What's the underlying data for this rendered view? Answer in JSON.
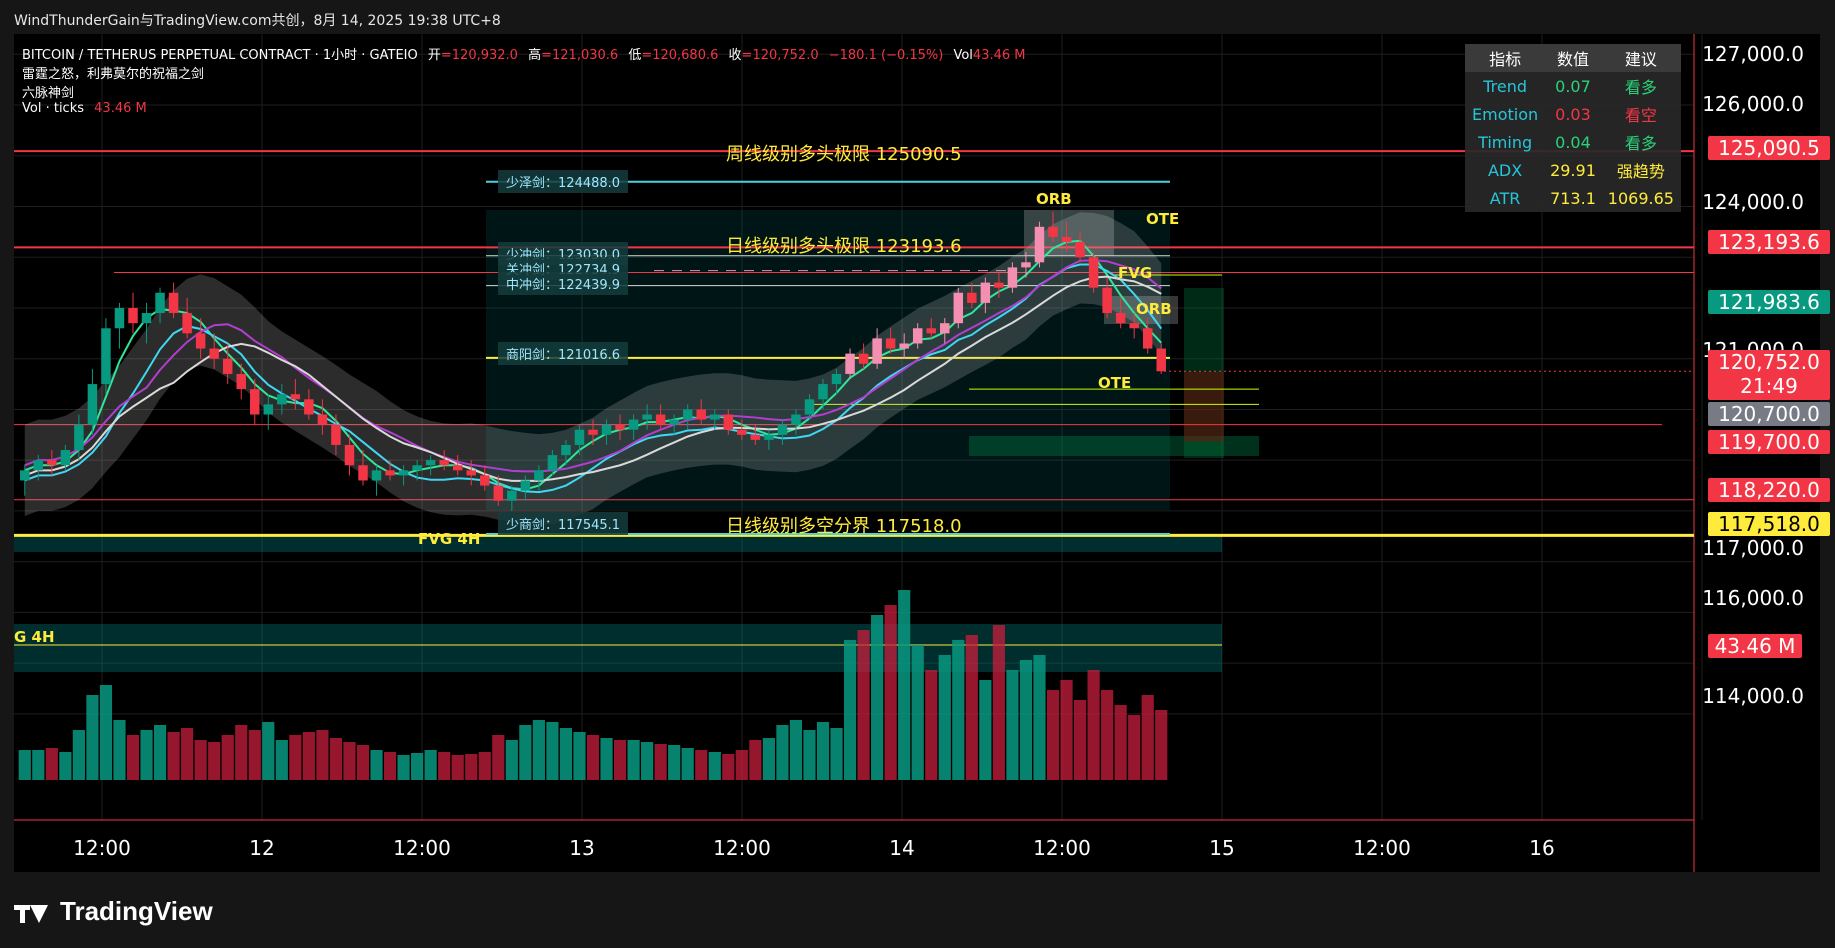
{
  "header": {
    "text": "WindThunderGain与TradingView.com共创，8月 14, 2025 19:38 UTC+8"
  },
  "legend": {
    "symbol": "BITCOIN / TETHERUS PERPETUAL CONTRACT · 1小时 · GATEIO",
    "o_label": "开",
    "o": "=120,932.0",
    "h_label": "高",
    "h": "=121,030.6",
    "l_label": "低",
    "l": "=120,680.6",
    "c_label": "收",
    "c": "=120,752.0",
    "change": "−180.1 (−0.15%)",
    "vol_label": "Vol",
    "vol": "43.46 M",
    "line2": "雷霆之怒，利弗莫尔的祝福之剑",
    "line3": "六脉神剑",
    "line4": "Vol · ticks",
    "line4_val": "43.46 M"
  },
  "indicator_table": {
    "headers": [
      "指标",
      "数值",
      "建议"
    ],
    "rows": [
      {
        "name": "Trend",
        "value": "0.07",
        "advice": "看多",
        "name_color": "#26c6da",
        "value_color": "#29d37a",
        "advice_color": "#29d37a"
      },
      {
        "name": "Emotion",
        "value": "0.03",
        "advice": "看空",
        "name_color": "#26c6da",
        "value_color": "#f23645",
        "advice_color": "#f23645"
      },
      {
        "name": "Timing",
        "value": "0.04",
        "advice": "看多",
        "name_color": "#26c6da",
        "value_color": "#29d37a",
        "advice_color": "#29d37a"
      },
      {
        "name": "ADX",
        "value": "29.91",
        "advice": "强趋势",
        "name_color": "#26c6da",
        "value_color": "#ffeb3b",
        "advice_color": "#ffeb3b"
      },
      {
        "name": "ATR",
        "value": "713.1",
        "advice": "1069.65",
        "name_color": "#26c6da",
        "value_color": "#ffeb3b",
        "advice_color": "#ffeb3b"
      }
    ]
  },
  "price_axis": [
    "127,000.0",
    "126,000.0",
    "124,000.0",
    "121,000.0",
    "117,000.0",
    "116,000.0",
    "114,000.0"
  ],
  "price_tags": [
    {
      "text": "125,090.5",
      "bg": "#f23645",
      "fg": "#ffffff",
      "price": 125090.5
    },
    {
      "text": "123,193.6",
      "bg": "#f23645",
      "fg": "#ffffff",
      "price": 123193.6
    },
    {
      "text": "121,983.6",
      "bg": "#089981",
      "fg": "#ffffff",
      "price": 121983.6
    },
    {
      "text": "120,752.0",
      "bg": "#f23645",
      "fg": "#ffffff",
      "price": 120752.0
    },
    {
      "text": "21:49",
      "bg": "#f23645",
      "fg": "#ffffff",
      "price": 120752.0
    },
    {
      "text": "120,700.0",
      "bg": "#787b86",
      "fg": "#ffffff",
      "price": 120700.0
    },
    {
      "text": "119,700.0",
      "bg": "#f23645",
      "fg": "#ffffff",
      "price": 119700.0
    },
    {
      "text": "118,220.0",
      "bg": "#f23645",
      "fg": "#ffffff",
      "price": 118220.0
    },
    {
      "text": "117,518.0",
      "bg": "#ffeb3b",
      "fg": "#000000",
      "price": 117518.0
    },
    {
      "text": "43.46 M",
      "bg": "#f23645",
      "fg": "#ffffff",
      "price": null
    }
  ],
  "time_axis": [
    "12:00",
    "12",
    "12:00",
    "13",
    "12:00",
    "14",
    "12:00",
    "15",
    "12:00",
    "16"
  ],
  "chart_labels": {
    "weekly": "周线级别多头极限 125090.5",
    "daily_bull": "日线级别多头极限 123193.6",
    "daily_split": "日线级别多空分界 117518.0",
    "fvg4h": "FVG 4H",
    "fvg4h_left": "G 4H",
    "orb": "ORB",
    "ote": "OTE",
    "fvg": "FVG"
  },
  "swords": [
    {
      "name": "少泽剑",
      "value": "124488.0"
    },
    {
      "name": "少冲剑",
      "value": "123030.0"
    },
    {
      "name": "关冲剑",
      "value": "122734.9"
    },
    {
      "name": "中冲剑",
      "value": "122439.9"
    },
    {
      "name": "商阳剑",
      "value": "121016.6"
    },
    {
      "name": "少商剑",
      "value": "117545.1"
    }
  ],
  "footer": {
    "brand": "TradingView"
  },
  "colors": {
    "up": "#089981",
    "down": "#f23645",
    "ma_magenta": "#b23ecf",
    "ma_green": "#2ee89a",
    "ma_cyan": "#3fd7f2",
    "ma_white": "#d9d9d9",
    "yellow": "#ffeb3b"
  },
  "chart_data": {
    "type": "candlestick",
    "price_range": [
      113800,
      127400
    ],
    "candles": [
      [
        118600,
        118900,
        118300,
        118800
      ],
      [
        118800,
        119100,
        118600,
        119000
      ],
      [
        119000,
        119200,
        118700,
        118900
      ],
      [
        118900,
        119300,
        118800,
        119200
      ],
      [
        119200,
        119900,
        119000,
        119700
      ],
      [
        119700,
        120800,
        119500,
        120500
      ],
      [
        120500,
        121800,
        120300,
        121600
      ],
      [
        121600,
        122100,
        121200,
        122000
      ],
      [
        122000,
        122300,
        121500,
        121700
      ],
      [
        121700,
        122100,
        121300,
        121900
      ],
      [
        121900,
        122400,
        121700,
        122300
      ],
      [
        122300,
        122500,
        121800,
        121900
      ],
      [
        121900,
        122200,
        121400,
        121500
      ],
      [
        121500,
        121800,
        121000,
        121200
      ],
      [
        121200,
        121500,
        120800,
        121000
      ],
      [
        121000,
        121300,
        120500,
        120700
      ],
      [
        120700,
        120900,
        120200,
        120400
      ],
      [
        120400,
        120600,
        119700,
        119900
      ],
      [
        119900,
        120300,
        119600,
        120100
      ],
      [
        120100,
        120500,
        119900,
        120300
      ],
      [
        120300,
        120600,
        120000,
        120200
      ],
      [
        120200,
        120400,
        119800,
        119900
      ],
      [
        119900,
        120200,
        119500,
        119700
      ],
      [
        119700,
        119900,
        119100,
        119300
      ],
      [
        119300,
        119500,
        118700,
        118900
      ],
      [
        118900,
        119200,
        118500,
        118600
      ],
      [
        118600,
        118900,
        118300,
        118800
      ],
      [
        118800,
        119000,
        118600,
        118700
      ],
      [
        118700,
        118900,
        118500,
        118800
      ],
      [
        118800,
        119000,
        118600,
        118900
      ],
      [
        118900,
        119100,
        118700,
        119000
      ],
      [
        119000,
        119200,
        118800,
        118900
      ],
      [
        118900,
        119100,
        118700,
        118800
      ],
      [
        118800,
        119000,
        118500,
        118700
      ],
      [
        118700,
        118900,
        118400,
        118500
      ],
      [
        118500,
        118700,
        118100,
        118200
      ],
      [
        118200,
        118500,
        118000,
        118400
      ],
      [
        118400,
        118700,
        118200,
        118600
      ],
      [
        118600,
        118900,
        118400,
        118800
      ],
      [
        118800,
        119200,
        118700,
        119100
      ],
      [
        119100,
        119400,
        118900,
        119300
      ],
      [
        119300,
        119700,
        119100,
        119600
      ],
      [
        119600,
        119800,
        119300,
        119500
      ],
      [
        119500,
        119800,
        119300,
        119700
      ],
      [
        119700,
        119900,
        119400,
        119600
      ],
      [
        119600,
        119900,
        119400,
        119800
      ],
      [
        119800,
        120100,
        119600,
        119900
      ],
      [
        119900,
        120100,
        119600,
        119700
      ],
      [
        119700,
        119900,
        119500,
        119800
      ],
      [
        119800,
        120100,
        119600,
        120000
      ],
      [
        120000,
        120200,
        119700,
        119800
      ],
      [
        119800,
        120000,
        119600,
        119900
      ],
      [
        119900,
        120000,
        119500,
        119600
      ],
      [
        119600,
        119800,
        119400,
        119500
      ],
      [
        119500,
        119700,
        119300,
        119400
      ],
      [
        119400,
        119600,
        119200,
        119500
      ],
      [
        119500,
        119800,
        119300,
        119700
      ],
      [
        119700,
        120000,
        119500,
        119900
      ],
      [
        119900,
        120300,
        119800,
        120200
      ],
      [
        120200,
        120600,
        120000,
        120500
      ],
      [
        120500,
        120800,
        120300,
        120700
      ],
      [
        120700,
        121200,
        120600,
        121100
      ],
      [
        121100,
        121300,
        120800,
        120900
      ],
      [
        120900,
        121600,
        120800,
        121400
      ],
      [
        121400,
        121600,
        121100,
        121200
      ],
      [
        121200,
        121500,
        121000,
        121300
      ],
      [
        121300,
        121700,
        121200,
        121600
      ],
      [
        121600,
        121800,
        121400,
        121500
      ],
      [
        121500,
        121800,
        121300,
        121700
      ],
      [
        121700,
        122400,
        121600,
        122300
      ],
      [
        122300,
        122500,
        122000,
        122100
      ],
      [
        122100,
        122600,
        121900,
        122500
      ],
      [
        122500,
        122700,
        122200,
        122400
      ],
      [
        122400,
        122900,
        122300,
        122800
      ],
      [
        122800,
        123100,
        122600,
        122900
      ],
      [
        122900,
        123700,
        122800,
        123600
      ],
      [
        123600,
        123900,
        123300,
        123400
      ],
      [
        123400,
        123700,
        123100,
        123300
      ],
      [
        123300,
        123500,
        122900,
        123000
      ],
      [
        123000,
        123100,
        122300,
        122400
      ],
      [
        122400,
        122600,
        121800,
        121900
      ],
      [
        121900,
        122200,
        121600,
        121700
      ],
      [
        121700,
        121900,
        121400,
        121600
      ],
      [
        121600,
        121800,
        121100,
        121200
      ],
      [
        121200,
        121300,
        120700,
        120752
      ]
    ],
    "volume_millions": [
      30,
      30,
      32,
      28,
      50,
      85,
      95,
      60,
      45,
      50,
      55,
      48,
      52,
      40,
      38,
      45,
      55,
      50,
      58,
      40,
      45,
      48,
      50,
      42,
      38,
      35,
      30,
      28,
      25,
      27,
      30,
      28,
      25,
      26,
      28,
      45,
      40,
      55,
      60,
      58,
      52,
      48,
      45,
      42,
      40,
      40,
      38,
      36,
      35,
      32,
      30,
      28,
      26,
      30,
      40,
      42,
      55,
      60,
      50,
      58,
      52,
      140,
      150,
      165,
      175,
      190,
      135,
      110,
      125,
      140,
      145,
      100,
      155,
      110,
      120,
      125,
      90,
      100,
      80,
      110,
      90,
      75,
      65,
      85,
      70
    ],
    "levels": [
      {
        "name": "周线级别多头极限",
        "value": 125090.5
      },
      {
        "name": "日线级别多头极限",
        "value": 123193.6
      },
      {
        "name": "日线级别多空分界",
        "value": 117518.0
      }
    ]
  }
}
